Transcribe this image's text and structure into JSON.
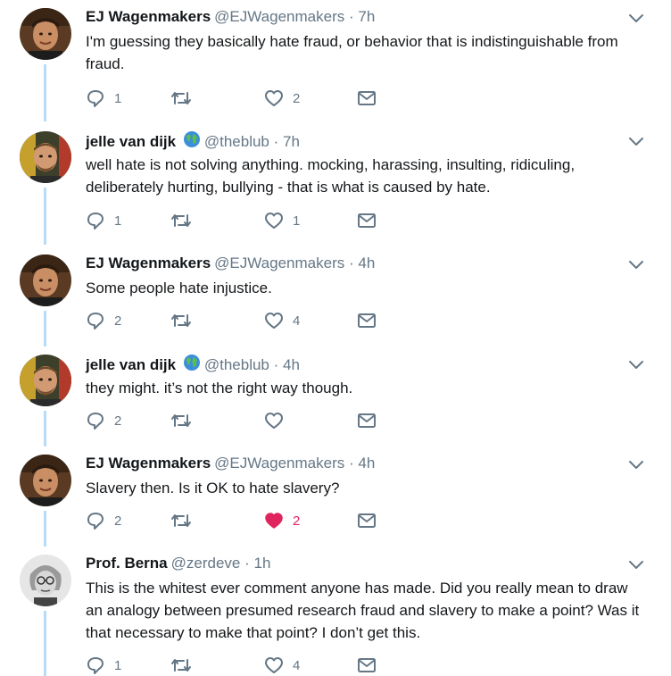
{
  "colors": {
    "text": "#14171a",
    "secondary": "#657786",
    "thread_line": "#b6dcf7",
    "like_active": "#e0245e"
  },
  "tweets": [
    {
      "name": "EJ Wagenmakers",
      "verified": false,
      "handle": "@EJWagenmakers",
      "dot": "·",
      "time": "7h",
      "text": "I'm guessing they basically hate fraud, or behavior that is indistinguishable from fraud.",
      "replies": "1",
      "retweets": "",
      "likes": "2",
      "liked": false,
      "avatar": "ej-avatar"
    },
    {
      "name": "jelle van dijk",
      "verified": true,
      "handle": "@theblub",
      "dot": "·",
      "time": "7h",
      "text": "well hate is not solving anything. mocking, harassing, insulting, ridiculing, deliberately hurting, bullying - that is what is caused by hate.",
      "replies": "1",
      "retweets": "",
      "likes": "1",
      "liked": false,
      "avatar": "jelle-avatar"
    },
    {
      "name": "EJ Wagenmakers",
      "verified": false,
      "handle": "@EJWagenmakers",
      "dot": "·",
      "time": "4h",
      "text": "Some people hate injustice.",
      "replies": "2",
      "retweets": "",
      "likes": "4",
      "liked": false,
      "avatar": "ej-avatar"
    },
    {
      "name": "jelle van dijk",
      "verified": true,
      "handle": "@theblub",
      "dot": "·",
      "time": "4h",
      "text": "they might. it’s not the right way though.",
      "replies": "2",
      "retweets": "",
      "likes": "",
      "liked": false,
      "avatar": "jelle-avatar"
    },
    {
      "name": "EJ Wagenmakers",
      "verified": false,
      "handle": "@EJWagenmakers",
      "dot": "·",
      "time": "4h",
      "text": "Slavery then. Is it OK to hate slavery?",
      "replies": "2",
      "retweets": "",
      "likes": "2",
      "liked": true,
      "avatar": "ej-avatar"
    },
    {
      "name": "Prof. Berna",
      "verified": false,
      "handle": "@zerdeve",
      "dot": "·",
      "time": "1h",
      "text": "This is the whitest ever comment anyone has made. Did you really mean to draw an analogy between presumed research fraud and slavery to make a point? Was it that necessary to make that point? I don’t get this.",
      "replies": "1",
      "retweets": "",
      "likes": "4",
      "liked": false,
      "avatar": "berna-avatar"
    }
  ]
}
